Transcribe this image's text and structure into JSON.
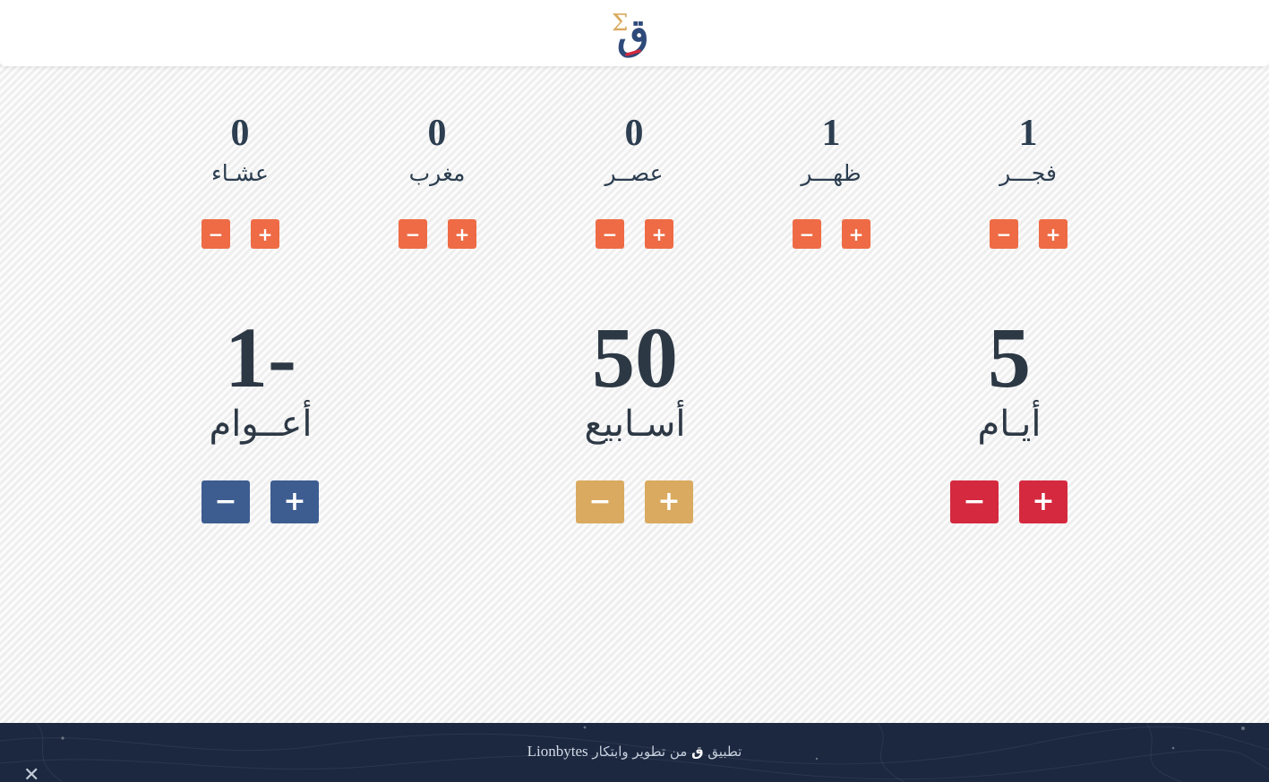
{
  "header": {
    "logo_letter": "ق",
    "logo_sigma": "Σ"
  },
  "prayers": [
    {
      "id": "fajr",
      "label": "فجـــر",
      "count": "1",
      "minus": "−",
      "plus": "+"
    },
    {
      "id": "dhuhr",
      "label": "ظهـــر",
      "count": "1",
      "minus": "−",
      "plus": "+"
    },
    {
      "id": "asr",
      "label": "عصــر",
      "count": "0",
      "minus": "−",
      "plus": "+"
    },
    {
      "id": "maghrib",
      "label": "مغرب",
      "count": "0",
      "minus": "−",
      "plus": "+"
    },
    {
      "id": "isha",
      "label": "عشـاء",
      "count": "0",
      "minus": "−",
      "plus": "+"
    }
  ],
  "totals": [
    {
      "id": "days",
      "label": "أيـام",
      "count": "5",
      "minus": "−",
      "plus": "+",
      "color": "#d4293e"
    },
    {
      "id": "weeks",
      "label": "أسـابيع",
      "count": "50",
      "minus": "−",
      "plus": "+",
      "color": "#d9aa5f"
    },
    {
      "id": "years",
      "label": "أعــوام",
      "count": "1-",
      "minus": "−",
      "plus": "+",
      "color": "#3d5d91"
    }
  ],
  "colors": {
    "prayer_button": "#ee6b45",
    "text": "#2c3e50",
    "footer_bg": "#1b2840"
  },
  "footer": {
    "prefix": "تطبيق",
    "app": "ق",
    "middle": "من تطوير وابتكار",
    "brand": "Lionbytes",
    "close": "✕"
  }
}
